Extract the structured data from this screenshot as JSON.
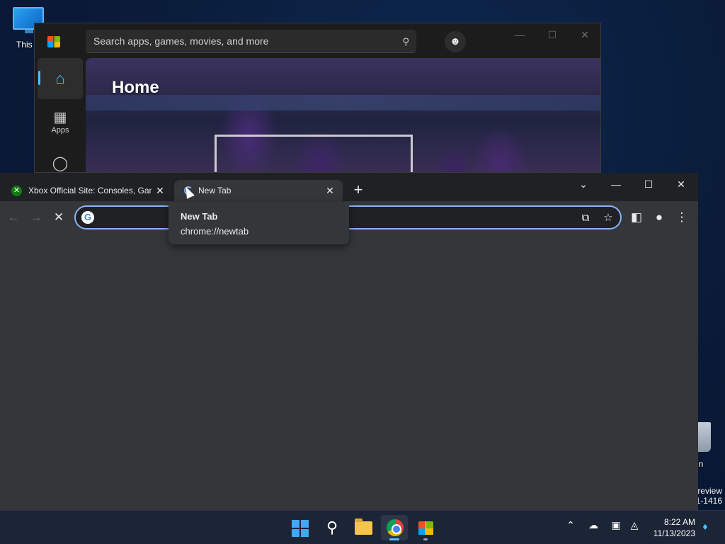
{
  "desktop": {
    "this_pc_label": "This P",
    "recycle_bin_label": "Bin",
    "watermark_line1": "review",
    "watermark_line2": "1-1416"
  },
  "store": {
    "search_placeholder": "Search apps, games, movies, and more",
    "nav": {
      "home_label": "",
      "apps_label": "Apps"
    },
    "hero_title": "Home",
    "window_controls": {
      "minimize": "—",
      "maximize": "☐",
      "close": "✕"
    }
  },
  "chrome": {
    "tabs": [
      {
        "title": "Xbox Official Site: Consoles, Games",
        "close": "✕"
      },
      {
        "title": "New Tab",
        "close": "✕"
      }
    ],
    "new_tab_symbol": "+",
    "tab_search_symbol": "⌄",
    "window_controls": {
      "minimize": "—",
      "maximize": "☐",
      "close": "✕"
    },
    "toolbar": {
      "back": "←",
      "forward": "→",
      "stop": "✕"
    },
    "omnibox": {
      "value": "",
      "placeholder": ""
    },
    "tooltip": {
      "title": "New Tab",
      "url": "chrome://newtab"
    }
  },
  "taskbar": {
    "apps": [
      "start",
      "search",
      "file-explorer",
      "chrome",
      "microsoft-store"
    ],
    "clock": {
      "time": "8:22 AM",
      "date": "11/13/2023"
    }
  },
  "colors": {
    "accent": "#4cc2ff",
    "chrome_focus": "#8ab4f8",
    "chrome_bg": "#202124",
    "chrome_toolbar": "#35363a",
    "taskbar": "#1b2536",
    "store_bg": "#1c1c1c"
  }
}
